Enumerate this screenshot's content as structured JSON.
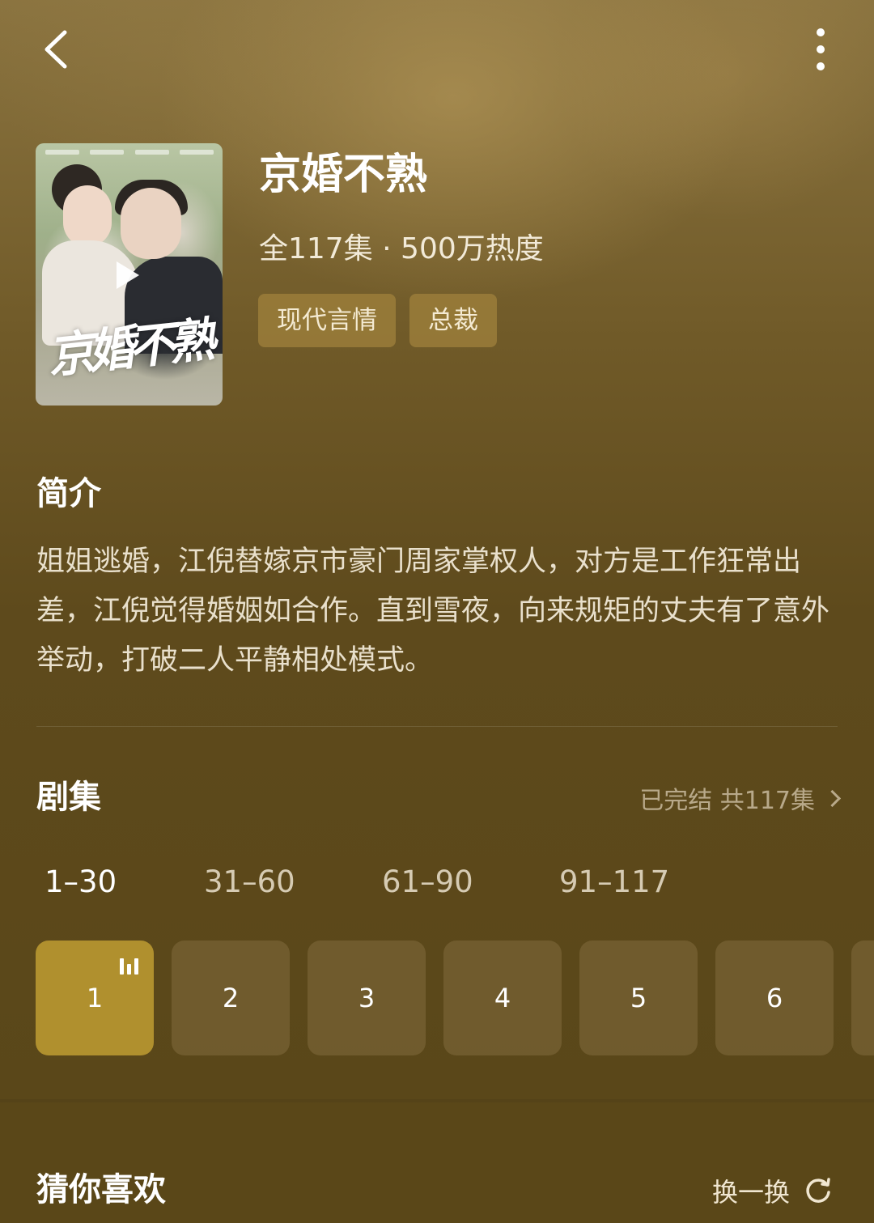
{
  "drama": {
    "title": "京婚不熟",
    "meta": "全117集 · 500万热度",
    "tags": [
      "现代言情",
      "总裁"
    ],
    "poster_logo": "京婚不熟"
  },
  "synopsis": {
    "heading": "简介",
    "text": "姐姐逃婚，江倪替嫁京市豪门周家掌权人，对方是工作狂常出差，江倪觉得婚姻如合作。直到雪夜，向来规矩的丈夫有了意外举动，打破二人平静相处模式。"
  },
  "episodes": {
    "heading": "剧集",
    "status": "已完结 共117集",
    "ranges": [
      "1–30",
      "31–60",
      "61–90",
      "91–117"
    ],
    "active_range": 0,
    "items": [
      "1",
      "2",
      "3",
      "4",
      "5",
      "6"
    ],
    "active_episode": "1"
  },
  "recommend": {
    "heading": "猜你喜欢",
    "refresh_label": "换一换"
  },
  "icons": {
    "back": "chevron-left-icon",
    "more": "more-vertical-icon",
    "play": "play-icon",
    "playing": "now-playing-icon",
    "status_chevron": "chevron-right-icon",
    "refresh": "refresh-icon"
  },
  "colors": {
    "background": "#5e4a1c",
    "accent": "#b0902e",
    "episode_tile": "#826c3e",
    "tag_bg": "#a0823c"
  }
}
